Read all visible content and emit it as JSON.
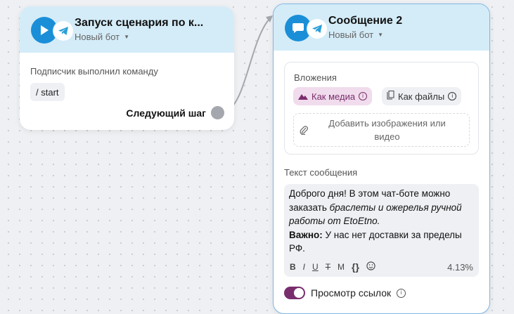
{
  "trigger_node": {
    "title": "Запуск сценария по к...",
    "bot": "Новый бот",
    "condition": "Подписчик выполнил команду",
    "command": "/ start",
    "next_step": "Следующий шаг"
  },
  "message_node": {
    "title": "Сообщение 2",
    "bot": "Новый бот",
    "attachments": {
      "label": "Вложения",
      "as_media": "Как медиа",
      "as_files": "Как файлы",
      "add_line1": "Добавить изображения или",
      "add_line2": "видео"
    },
    "message": {
      "label": "Текст сообщения",
      "line1": "Доброго дня! В этом чат-боте можно",
      "line2_prefix": "заказать ",
      "line2_italic": "браслеты и ожерелья ручной",
      "line3_italic": "работы от EtoEtno.",
      "line4_bold": "Важно:",
      "line4_rest": " У нас нет доставки за пределы",
      "line5": "РФ.",
      "char_usage": "4.13%"
    },
    "toolbar": {
      "bold": "B",
      "italic": "I",
      "underline": "U",
      "strike": "T",
      "mono": "M",
      "code": "{}"
    },
    "link_preview": {
      "label": "Просмотр ссылок",
      "enabled": true
    }
  },
  "colors": {
    "header_bg": "#d4ecf8",
    "brand_blue": "#1a8fd8",
    "accent_purple": "#7a2d6d",
    "media_pill_bg": "#f0dcec"
  }
}
